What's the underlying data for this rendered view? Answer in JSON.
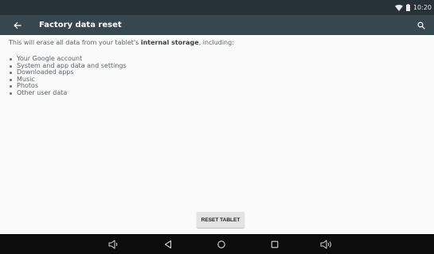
{
  "status_bar": {
    "time": "10:20",
    "icons": [
      "wifi-icon",
      "battery-icon"
    ]
  },
  "app_bar": {
    "title": "Factory data reset",
    "back_icon": "arrow-back-icon",
    "search_icon": "search-icon"
  },
  "content": {
    "intro_before": "This will erase all data from your tablet's ",
    "intro_bold": "internal storage",
    "intro_after": ", including:",
    "items": [
      "Your Google account",
      "System and app data and settings",
      "Downloaded apps",
      "Music",
      "Photos",
      "Other user data"
    ]
  },
  "reset_button": {
    "label": "RESET TABLET"
  },
  "nav_bar": {
    "icons": [
      "volume-down-icon",
      "back-triangle-icon",
      "home-circle-icon",
      "recents-square-icon",
      "volume-up-icon"
    ]
  },
  "colors": {
    "status_bar": "#263238",
    "app_bar": "#37474f",
    "nav_bar": "#0c0c0c",
    "background": "#fafafa",
    "button": "#e3e3e3"
  }
}
